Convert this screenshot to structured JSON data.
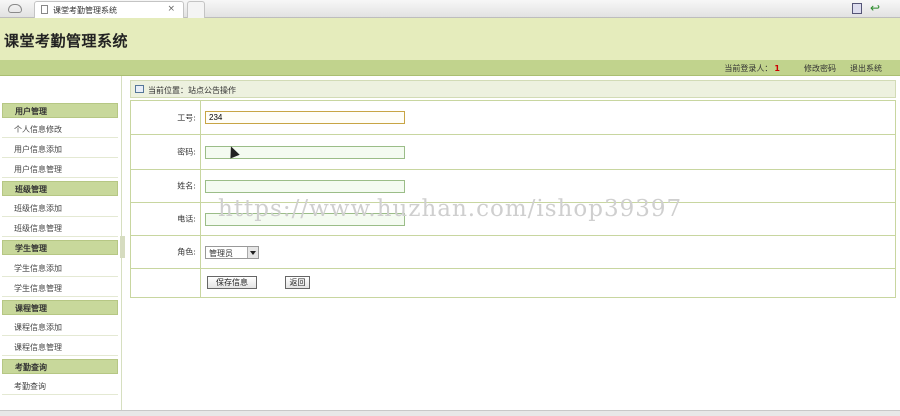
{
  "browser": {
    "tab_title": "课堂考勤管理系统",
    "tab_close": "×",
    "back_icon": "↩"
  },
  "header": {
    "app_title": "课堂考勤管理系统"
  },
  "userbar": {
    "current_user_label": "当前登录人：",
    "current_user": "1",
    "change_password": "修改密码",
    "logout": "退出系统"
  },
  "sidebar": {
    "sections": [
      {
        "title": "用户管理",
        "items": [
          "个人信息修改",
          "用户信息添加",
          "用户信息管理"
        ]
      },
      {
        "title": "班级管理",
        "items": [
          "班级信息添加",
          "班级信息管理"
        ]
      },
      {
        "title": "学生管理",
        "items": [
          "学生信息添加",
          "学生信息管理"
        ]
      },
      {
        "title": "课程管理",
        "items": [
          "课程信息添加",
          "课程信息管理"
        ]
      },
      {
        "title": "考勤查询",
        "items": [
          "考勤查询"
        ]
      }
    ]
  },
  "breadcrumb": {
    "text": "当前位置：站点公告操作"
  },
  "form": {
    "fields": [
      {
        "label": "工号:",
        "value": "234"
      },
      {
        "label": "密码:",
        "value": ""
      },
      {
        "label": "姓名:",
        "value": ""
      },
      {
        "label": "电话:",
        "value": ""
      }
    ],
    "role_label": "角色:",
    "role_value": "管理员",
    "save_label": "保存信息",
    "back_label": "返回"
  },
  "watermark": "https://www.huzhan.com/ishop39397",
  "colors": {
    "header_bg": "#e5ecbc",
    "bar_green": "#c1d38d",
    "section_bg": "#c8d89b",
    "accent_red": "#cc0000"
  }
}
